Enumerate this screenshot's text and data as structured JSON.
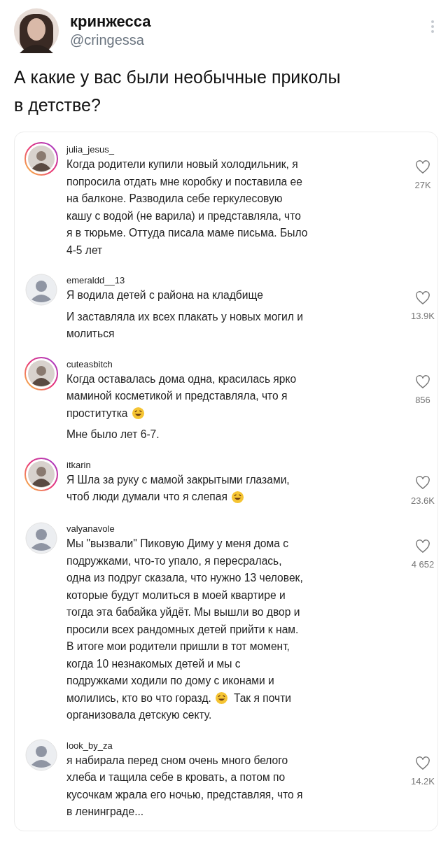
{
  "tweet": {
    "author_name": "кринжесса",
    "author_handle": "@cringessa",
    "text": "А какие у вас были необычные приколы в детстве?"
  },
  "comments": [
    {
      "username": "julia_jesus_",
      "ring": true,
      "likes": "27K",
      "paragraphs": [
        [
          [
            {
              "kind": "text",
              "text": "Когда родители купили новый холодильник, я"
            }
          ],
          [
            {
              "kind": "text",
              "text": "попросила отдать мне коробку и поставила ее"
            }
          ],
          [
            {
              "kind": "text",
              "text": "на балконе. Разводила себе геркулесовую"
            }
          ],
          [
            {
              "kind": "text",
              "text": "кашу с водой (не варила) и представляла, что"
            }
          ],
          [
            {
              "kind": "text",
              "text": "я в тюрьме. Оттуда писала маме письма. Было"
            }
          ],
          [
            {
              "kind": "text",
              "text": "4-5 лет"
            }
          ]
        ]
      ]
    },
    {
      "username": "emeraldd__13",
      "ring": false,
      "likes": "13.9K",
      "paragraphs": [
        [
          [
            {
              "kind": "text",
              "text": "Я водила детей с района на кладбище"
            }
          ]
        ],
        [
          [
            {
              "kind": "text",
              "text": "И заставляла их всех плакать у новых могил и"
            }
          ],
          [
            {
              "kind": "text",
              "text": "молиться"
            }
          ]
        ]
      ]
    },
    {
      "username": "cuteasbitch",
      "ring": true,
      "likes": "856",
      "paragraphs": [
        [
          [
            {
              "kind": "text",
              "text": "Когда оставалась дома одна, красилась ярко"
            }
          ],
          [
            {
              "kind": "text",
              "text": "маминой косметикой и представляла, что я"
            }
          ],
          [
            {
              "kind": "text",
              "text": "проститутка"
            },
            {
              "kind": "emoji"
            }
          ]
        ],
        [
          [
            {
              "kind": "text",
              "text": "Мне было лет 6-7."
            }
          ]
        ]
      ]
    },
    {
      "username": "itkarin",
      "ring": true,
      "likes": "23.6K",
      "paragraphs": [
        [
          [
            {
              "kind": "text",
              "text": "Я Шла за руку с мамой закрытыми глазами,"
            }
          ],
          [
            {
              "kind": "text",
              "text": "чтоб люди думали что я слепая"
            },
            {
              "kind": "emoji"
            }
          ]
        ]
      ]
    },
    {
      "username": "valyanavole",
      "ring": false,
      "likes": "4 652",
      "paragraphs": [
        [
          [
            {
              "kind": "text",
              "text": "Мы \"вызвали\" Пиковую Диму у меня дома с"
            }
          ],
          [
            {
              "kind": "text",
              "text": "подружками, что-то упало, я пересралась,"
            }
          ],
          [
            {
              "kind": "text",
              "text": "одна из подруг сказала, что нужно 13 человек,"
            }
          ],
          [
            {
              "kind": "text",
              "text": "которые будут молиться в моей квартире и"
            }
          ],
          [
            {
              "kind": "text",
              "text": "тогда эта бабайка уйдёт. Мы вышли во двор и"
            }
          ],
          [
            {
              "kind": "text",
              "text": "просили всех рандомных детей прийти к нам."
            }
          ],
          [
            {
              "kind": "text",
              "text": "В итоге мои родители пришли в тот момент,"
            }
          ],
          [
            {
              "kind": "text",
              "text": "когда 10 незнакомых детей и мы с"
            }
          ],
          [
            {
              "kind": "text",
              "text": "подружками ходили по дому с иконами и"
            }
          ],
          [
            {
              "kind": "text",
              "text": "молились, кто во что горазд."
            },
            {
              "kind": "emoji"
            },
            {
              "kind": "text",
              "text": "Так я почти"
            }
          ],
          [
            {
              "kind": "text",
              "text": "организовала детскую секту."
            }
          ]
        ]
      ]
    },
    {
      "username": "look_by_za",
      "ring": false,
      "likes": "14.2K",
      "paragraphs": [
        [
          [
            {
              "kind": "text",
              "text": "я набирала перед сном очень много белого"
            }
          ],
          [
            {
              "kind": "text",
              "text": "хлеба и тащила себе в кровать, а потом по"
            }
          ],
          [
            {
              "kind": "text",
              "text": "кусочкам жрала его ночью, представляя, что я"
            }
          ],
          [
            {
              "kind": "text",
              "text": "в ленинграде..."
            }
          ]
        ]
      ]
    }
  ]
}
